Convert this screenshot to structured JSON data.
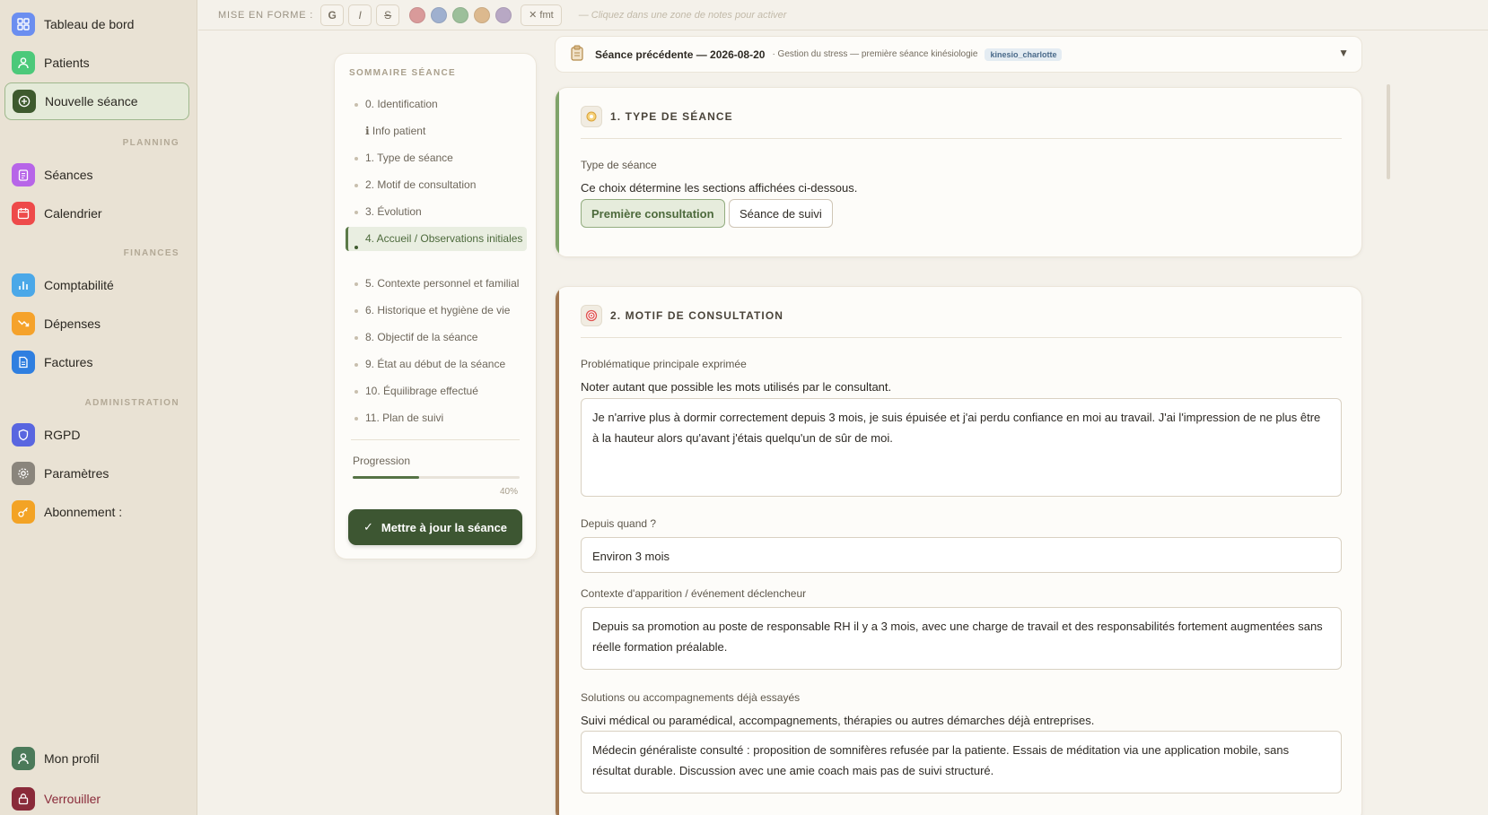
{
  "sidebar": {
    "items": [
      {
        "label": "Tableau de bord",
        "icon": "dashboard-icon",
        "color": "#6b8ef0"
      },
      {
        "label": "Patients",
        "icon": "user-icon",
        "color": "#4cc97a"
      },
      {
        "label": "Nouvelle séance",
        "icon": "plus-circle-icon",
        "color": "#3e5a2e"
      },
      {
        "label": "Séances",
        "icon": "clipboard-icon",
        "color": "#b765e8"
      },
      {
        "label": "Calendrier",
        "icon": "calendar-icon",
        "color": "#ee4a4a"
      },
      {
        "label": "Comptabilité",
        "icon": "bar-chart-icon",
        "color": "#4ba8e8"
      },
      {
        "label": "Dépenses",
        "icon": "trending-down-icon",
        "color": "#f5a22b"
      },
      {
        "label": "Factures",
        "icon": "document-icon",
        "color": "#2f7fe0"
      },
      {
        "label": "RGPD",
        "icon": "shield-icon",
        "color": "#5966e0"
      },
      {
        "label": "Paramètres",
        "icon": "gear-icon",
        "color": "#8a857c"
      },
      {
        "label": "Abonnement :",
        "icon": "key-icon",
        "color": "#f3a325"
      }
    ],
    "sections": {
      "planning": "PLANNING",
      "finances": "FINANCES",
      "administration": "ADMINISTRATION"
    },
    "bottom": [
      {
        "label": "Mon profil",
        "icon": "user-icon",
        "color": "#4b7a5a"
      },
      {
        "label": "Verrouiller",
        "icon": "lock-icon",
        "color": "#8a2b3a"
      }
    ]
  },
  "format_bar": {
    "label": "MISE EN FORME :",
    "bold": "G",
    "italic": "I",
    "strike": "S",
    "colors": [
      "#d99a9a",
      "#9fb0cf",
      "#9cbf9a",
      "#dcb98e",
      "#b8a8c4"
    ],
    "clear": "✕ fmt",
    "hint": "— Cliquez dans une zone de notes pour activer"
  },
  "summary": {
    "title": "SOMMAIRE SÉANCE",
    "items": [
      "0. Identification",
      "ℹ Info patient",
      "1. Type de séance",
      "2. Motif de consultation",
      "3. Évolution",
      "4. Accueil / Observations initiales",
      "5. Contexte personnel et familial",
      "6. Historique et hygiène de vie",
      "8. Objectif de la séance",
      "9. État au début de la séance",
      "10. Équilibrage effectué",
      "11. Plan de suivi"
    ],
    "active_index": 5,
    "progress_label": "Progression",
    "progress_value": 0.4,
    "progress_text": "40%",
    "update_button": "Mettre à jour la séance"
  },
  "previous_session": {
    "title": "Séance précédente — 2026-08-20",
    "subtitle": "· Gestion du stress — première séance kinésiologie",
    "tag": "kinesio_charlotte",
    "chevron": "▼"
  },
  "section1": {
    "title": "1. TYPE DE SÉANCE",
    "field_label": "Type de séance",
    "help": "Ce choix détermine les sections affichées ci-dessous.",
    "option_selected": "Première consultation",
    "option_other": "Séance de suivi",
    "accent": "#7fa36a"
  },
  "section2": {
    "title": "2. MOTIF DE CONSULTATION",
    "accent": "#a07650",
    "problem_label": "Problématique principale exprimée",
    "problem_help": "Noter autant que possible les mots utilisés par le consultant.",
    "problem_value": "Je n'arrive plus à dormir correctement depuis 3 mois, je suis épuisée et j'ai perdu confiance en moi au travail. J'ai l'impression de ne plus être à la hauteur alors qu'avant j'étais quelqu'un de sûr de moi.",
    "since_label": "Depuis quand ?",
    "since_value": "Environ 3 mois",
    "context_label": "Contexte d'apparition / événement déclencheur",
    "context_value": "Depuis sa promotion au poste de responsable RH il y a 3 mois, avec une charge de travail et des responsabilités fortement augmentées sans réelle formation préalable.",
    "solutions_label": "Solutions ou accompagnements déjà essayés",
    "solutions_help": "Suivi médical ou paramédical, accompagnements, thérapies ou autres démarches déjà entreprises.",
    "solutions_value": "Médecin généraliste consulté : proposition de somnifères refusée par la patiente. Essais de méditation via une application mobile, sans résultat durable. Discussion avec une amie coach mais pas de suivi structuré."
  }
}
